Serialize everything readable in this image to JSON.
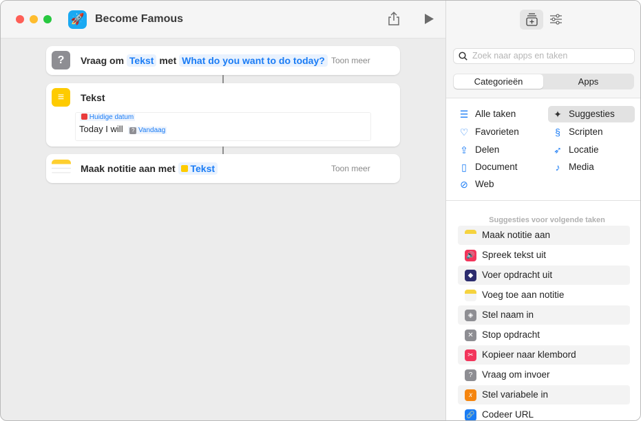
{
  "window": {
    "title": "Become Famous",
    "app_icon": "rocket-icon"
  },
  "editor": {
    "actions": [
      {
        "icon": "question-icon",
        "verb": "Vraag om",
        "token1": "Tekst",
        "mid": "met",
        "token2": "What do you want to do today?",
        "more": "Toon meer"
      },
      {
        "icon": "text-icon",
        "title": "Tekst",
        "var_date": "Huidige datum",
        "body": "Today I will",
        "var_today": "Vandaag"
      },
      {
        "icon": "notes-icon",
        "verb": "Maak notitie aan met",
        "token1": "Tekst",
        "more": "Toon meer"
      }
    ]
  },
  "panel": {
    "search_placeholder": "Zoek naar apps en taken",
    "segments": [
      "Categorieën",
      "Apps"
    ],
    "selected_segment": "Categorieën",
    "categories": [
      {
        "label": "Alle taken",
        "icon": "list-icon"
      },
      {
        "label": "Favorieten",
        "icon": "heart-icon"
      },
      {
        "label": "Delen",
        "icon": "share-icon"
      },
      {
        "label": "Document",
        "icon": "document-icon"
      },
      {
        "label": "Web",
        "icon": "compass-icon"
      },
      {
        "label": "Suggesties",
        "icon": "sparkles-icon",
        "selected": true
      },
      {
        "label": "Scripten",
        "icon": "scroll-icon"
      },
      {
        "label": "Locatie",
        "icon": "location-icon"
      },
      {
        "label": "Media",
        "icon": "music-icon"
      }
    ],
    "suggestions_header": "Suggesties voor volgende taken",
    "suggestions": [
      {
        "label": "Maak notitie aan",
        "icon": "notes-icon",
        "color": "#f5d33f"
      },
      {
        "label": "Spreek tekst uit",
        "icon": "speaker-icon",
        "color": "#f2355b"
      },
      {
        "label": "Voer opdracht uit",
        "icon": "shortcuts-icon",
        "color": "#2c2c6e"
      },
      {
        "label": "Voeg toe aan notitie",
        "icon": "notes-icon",
        "color": "#f5d33f"
      },
      {
        "label": "Stel naam in",
        "icon": "tag-icon",
        "color": "#8e8e93"
      },
      {
        "label": "Stop opdracht",
        "icon": "x-icon",
        "color": "#8e8e93"
      },
      {
        "label": "Kopieer naar klembord",
        "icon": "scissors-icon",
        "color": "#f2355b"
      },
      {
        "label": "Vraag om invoer",
        "icon": "question-icon",
        "color": "#8e8e93"
      },
      {
        "label": "Stel variabele in",
        "icon": "variable-icon",
        "color": "#f5850f"
      },
      {
        "label": "Codeer URL",
        "icon": "link-icon",
        "color": "#1a7cf5"
      }
    ]
  }
}
